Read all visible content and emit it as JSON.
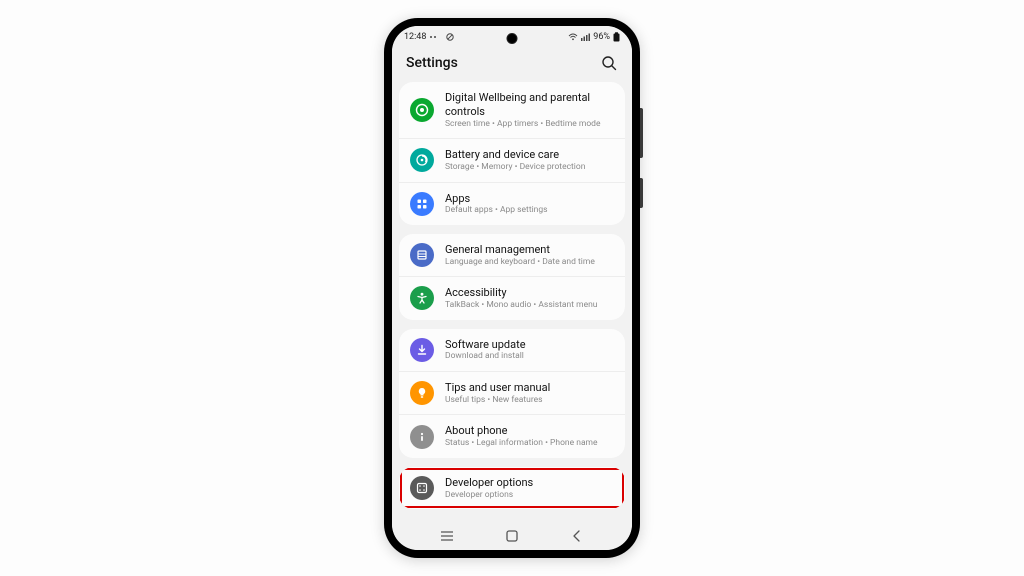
{
  "status": {
    "time": "12:48",
    "battery": "96%"
  },
  "header": {
    "title": "Settings"
  },
  "groups": [
    {
      "rows": [
        {
          "icon": "wellbeing",
          "color": "#0aa830",
          "title": "Digital Wellbeing and parental controls",
          "sub": "Screen time  •  App timers  •  Bedtime mode"
        },
        {
          "icon": "battery",
          "color": "#00a99d",
          "title": "Battery and device care",
          "sub": "Storage  •  Memory  •  Device protection"
        },
        {
          "icon": "apps",
          "color": "#3a7bff",
          "title": "Apps",
          "sub": "Default apps  •  App settings"
        }
      ]
    },
    {
      "rows": [
        {
          "icon": "general",
          "color": "#4a6bc7",
          "title": "General management",
          "sub": "Language and keyboard  •  Date and time"
        },
        {
          "icon": "access",
          "color": "#1b9e4b",
          "title": "Accessibility",
          "sub": "TalkBack  •  Mono audio  •  Assistant menu"
        }
      ]
    },
    {
      "rows": [
        {
          "icon": "update",
          "color": "#6b5ce5",
          "title": "Software update",
          "sub": "Download and install"
        },
        {
          "icon": "tips",
          "color": "#ff9500",
          "title": "Tips and user manual",
          "sub": "Useful tips  •  New features"
        },
        {
          "icon": "about",
          "color": "#8f8f8f",
          "title": "About phone",
          "sub": "Status  •  Legal information  •  Phone name"
        }
      ]
    },
    {
      "rows": [
        {
          "icon": "dev",
          "color": "#5a5a5a",
          "title": "Developer options",
          "sub": "Developer options",
          "highlight": true
        }
      ]
    }
  ]
}
